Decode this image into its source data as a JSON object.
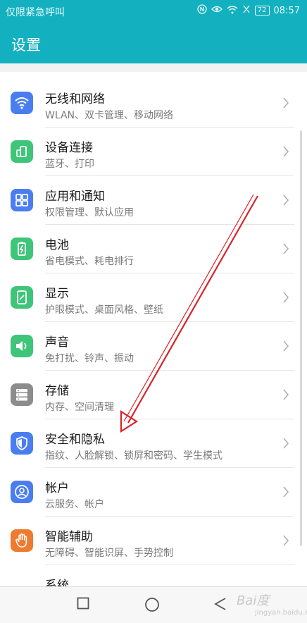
{
  "status": {
    "carrier": "仅限紧急呼叫",
    "battery": "72",
    "time": "08:57"
  },
  "header": {
    "title": "设置"
  },
  "items": [
    {
      "label": "无线和网络",
      "sub": "WLAN、双卡管理、移动网络",
      "icon": "wifi-icon",
      "color": "#4a7ef0"
    },
    {
      "label": "设备连接",
      "sub": "蓝牙、打印",
      "icon": "device-connect-icon",
      "color": "#3fc57a"
    },
    {
      "label": "应用和通知",
      "sub": "权限管理、默认应用",
      "icon": "apps-grid-icon",
      "color": "#4a7ef0"
    },
    {
      "label": "电池",
      "sub": "省电模式、耗电排行",
      "icon": "battery-icon",
      "color": "#3fc57a"
    },
    {
      "label": "显示",
      "sub": "护眼模式、桌面风格、壁纸",
      "icon": "display-icon",
      "color": "#3fc57a"
    },
    {
      "label": "声音",
      "sub": "免打扰、铃声、振动",
      "icon": "sound-icon",
      "color": "#3fc57a"
    },
    {
      "label": "存储",
      "sub": "内存、空间清理",
      "icon": "storage-icon",
      "color": "#8c8c8c"
    },
    {
      "label": "安全和隐私",
      "sub": "指纹、人脸解锁、锁屏和密码、学生模式",
      "icon": "shield-icon",
      "color": "#4a7ef0"
    },
    {
      "label": "帐户",
      "sub": "云服务、帐户",
      "icon": "account-icon",
      "color": "#4a7ef0"
    },
    {
      "label": "智能辅助",
      "sub": "无障碍、智能识屏、手势控制",
      "icon": "hand-icon",
      "color": "#f07a2e"
    },
    {
      "label": "系统",
      "sub": "",
      "icon": "system-icon",
      "color": "#8c8c8c"
    }
  ],
  "watermark": {
    "brand": "Bai度",
    "sub": "jingyan.baidu.com"
  }
}
